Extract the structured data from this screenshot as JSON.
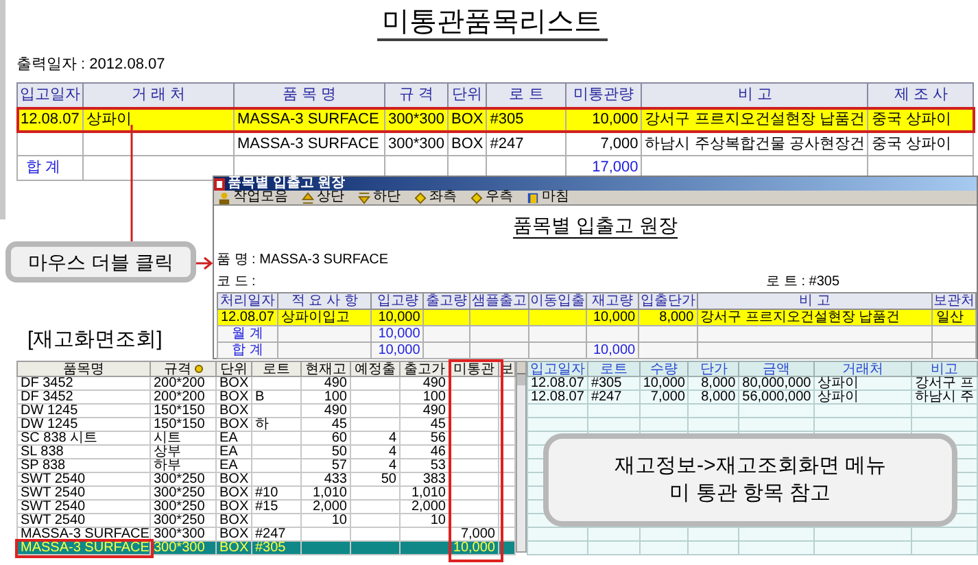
{
  "report": {
    "title": "미통관품목리스트",
    "print_date": "출력일자 : 2012.08.07",
    "columns": [
      "입고일자",
      "거 래 처",
      "품 목 명",
      "규 격",
      "단위",
      "로 트",
      "미통관량",
      "비 고",
      "제 조 사"
    ],
    "rows": [
      {
        "selected": true,
        "cells": [
          "12.08.07",
          "상파이",
          "MASSA-3 SURFACE",
          "300*300",
          "BOX",
          "#305",
          "10,000",
          "강서구 프르지오건설현장 납품건",
          "중국 상파이"
        ]
      },
      {
        "selected": false,
        "cells": [
          "",
          "",
          "MASSA-3 SURFACE",
          "300*300",
          "BOX",
          "#247",
          "7,000",
          "하남시 주상복합건물 공사현장건",
          "중국 상파이"
        ]
      }
    ],
    "total": {
      "label": "합 계",
      "value": "17,000"
    }
  },
  "callout": "마우스 더블 클릭",
  "ledger_window": {
    "title": "품목별 입출고 원장",
    "toolbar": [
      "작업모음",
      "상단",
      "하단",
      "좌측",
      "우측",
      "마침"
    ],
    "heading": "품목별 입출고 원장",
    "item_name": "품 명 : MASSA-3 SURFACE",
    "code": "코 드 :",
    "lot": "로 트 : #305",
    "columns": [
      "처리일자",
      "적 요 사 항",
      "입고량",
      "출고량",
      "샘플출고",
      "이동입출",
      "재고량",
      "입출단가",
      "비 고",
      "보관처"
    ],
    "rows": [
      {
        "kind": "entry",
        "cells": [
          "12.08.07",
          "상파이입고",
          "10,000",
          "",
          "",
          "",
          "10,000",
          "8,000",
          "강서구 프르지오건설현장 납품건",
          "일산"
        ]
      },
      {
        "kind": "total",
        "cells": [
          "월 계",
          "",
          "10,000",
          "",
          "",
          "",
          "",
          "",
          "",
          ""
        ]
      },
      {
        "kind": "total",
        "cells": [
          "합 계",
          "",
          "10,000",
          "",
          "",
          "",
          "10,000",
          "",
          "",
          ""
        ]
      }
    ]
  },
  "section_label": "[재고화면조회]",
  "stock_grid": {
    "columns": [
      "품목명",
      "규격",
      "단위",
      "로트",
      "현재고",
      "예정출",
      "출고가",
      "미통관",
      "보"
    ],
    "rows": [
      {
        "selected": false,
        "cells": [
          "DF 3452",
          "200*200",
          "BOX",
          "",
          "490",
          "",
          "490",
          ""
        ]
      },
      {
        "selected": false,
        "cells": [
          "DF 3452",
          "200*200",
          "BOX",
          "B",
          "100",
          "",
          "100",
          ""
        ]
      },
      {
        "selected": false,
        "cells": [
          "DW 1245",
          "150*150",
          "BOX",
          "",
          "490",
          "",
          "490",
          ""
        ]
      },
      {
        "selected": false,
        "cells": [
          "DW 1245",
          "150*150",
          "BOX",
          "하",
          "45",
          "",
          "45",
          ""
        ]
      },
      {
        "selected": false,
        "cells": [
          "SC 838 시트",
          "시트",
          "EA",
          "",
          "60",
          "4",
          "56",
          ""
        ]
      },
      {
        "selected": false,
        "cells": [
          "SL 838",
          "상부",
          "EA",
          "",
          "50",
          "4",
          "46",
          ""
        ]
      },
      {
        "selected": false,
        "cells": [
          "SP 838",
          "하부",
          "EA",
          "",
          "57",
          "4",
          "53",
          ""
        ]
      },
      {
        "selected": false,
        "cells": [
          "SWT 2540",
          "300*250",
          "BOX",
          "",
          "433",
          "50",
          "383",
          ""
        ]
      },
      {
        "selected": false,
        "cells": [
          "SWT 2540",
          "300*250",
          "BOX",
          "#10",
          "1,010",
          "",
          "1,010",
          ""
        ]
      },
      {
        "selected": false,
        "cells": [
          "SWT 2540",
          "300*250",
          "BOX",
          "#15",
          "2,000",
          "",
          "2,000",
          ""
        ]
      },
      {
        "selected": false,
        "cells": [
          "SWT 2540",
          "300*250",
          "BOX",
          "",
          "10",
          "",
          "10",
          ""
        ]
      },
      {
        "selected": false,
        "cells": [
          "MASSA-3 SURFACE",
          "300*300",
          "BOX",
          "#247",
          "",
          "",
          "",
          "7,000"
        ]
      },
      {
        "selected": true,
        "cells": [
          "MASSA-3 SURFACE",
          "300*300",
          "BOX",
          "#305",
          "",
          "",
          "",
          "10,000"
        ]
      }
    ]
  },
  "receipt_grid": {
    "columns": [
      "입고일자",
      "로트",
      "수량",
      "단가",
      "금액",
      "거래처",
      "비고"
    ],
    "rows": [
      {
        "cells": [
          "12.08.07",
          "#305",
          "10,000",
          "8,000",
          "80,000,000",
          "상파이",
          "강서구 프"
        ]
      },
      {
        "cells": [
          "12.08.07",
          "#247",
          "7,000",
          "8,000",
          "56,000,000",
          "상파이",
          "하남시 주"
        ]
      }
    ]
  },
  "note": [
    "재고정보->재고조회화면 메뉴",
    "미 통관 항목 참고"
  ]
}
